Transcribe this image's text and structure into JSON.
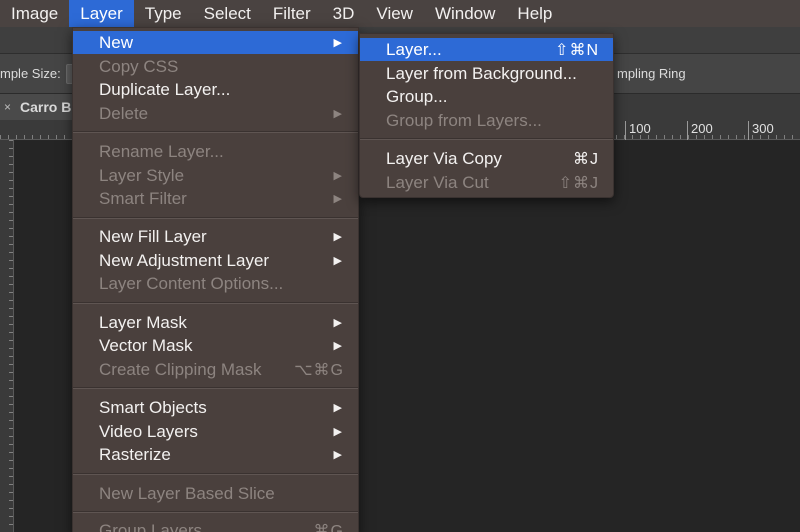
{
  "menubar": {
    "items": [
      "Image",
      "Layer",
      "Type",
      "Select",
      "Filter",
      "3D",
      "View",
      "Window",
      "Help"
    ],
    "active_index": 1
  },
  "options_bar": {
    "sample_size_label": "mple Size:",
    "sampling_ring_label": "mpling Ring"
  },
  "document_tab": {
    "close_glyph": "×",
    "name": "Carro B"
  },
  "ruler": {
    "ticks": [
      "100",
      "200",
      "300"
    ]
  },
  "layer_menu": {
    "items": [
      {
        "label": "New",
        "arrow": "▶",
        "shortcut": "",
        "state": "highlight"
      },
      {
        "label": "Copy CSS",
        "arrow": "",
        "shortcut": "",
        "state": "disabled"
      },
      {
        "label": "Duplicate Layer...",
        "arrow": "",
        "shortcut": "",
        "state": "enabled"
      },
      {
        "label": "Delete",
        "arrow": "▶",
        "shortcut": "",
        "state": "disabled"
      },
      {
        "label": "Rename Layer...",
        "arrow": "",
        "shortcut": "",
        "state": "disabled"
      },
      {
        "label": "Layer Style",
        "arrow": "▶",
        "shortcut": "",
        "state": "disabled"
      },
      {
        "label": "Smart Filter",
        "arrow": "▶",
        "shortcut": "",
        "state": "disabled"
      },
      {
        "label": "New Fill Layer",
        "arrow": "▶",
        "shortcut": "",
        "state": "enabled"
      },
      {
        "label": "New Adjustment Layer",
        "arrow": "▶",
        "shortcut": "",
        "state": "enabled"
      },
      {
        "label": "Layer Content Options...",
        "arrow": "",
        "shortcut": "",
        "state": "disabled"
      },
      {
        "label": "Layer Mask",
        "arrow": "▶",
        "shortcut": "",
        "state": "enabled"
      },
      {
        "label": "Vector Mask",
        "arrow": "▶",
        "shortcut": "",
        "state": "enabled"
      },
      {
        "label": "Create Clipping Mask",
        "arrow": "",
        "shortcut": "⌥⌘G",
        "state": "disabled"
      },
      {
        "label": "Smart Objects",
        "arrow": "▶",
        "shortcut": "",
        "state": "enabled"
      },
      {
        "label": "Video Layers",
        "arrow": "▶",
        "shortcut": "",
        "state": "enabled"
      },
      {
        "label": "Rasterize",
        "arrow": "▶",
        "shortcut": "",
        "state": "enabled"
      },
      {
        "label": "New Layer Based Slice",
        "arrow": "",
        "shortcut": "",
        "state": "disabled"
      },
      {
        "label": "Group Layers",
        "arrow": "",
        "shortcut": "⌘G",
        "state": "disabled"
      }
    ]
  },
  "new_submenu": {
    "items": [
      {
        "label": "Layer...",
        "shortcut": "⇧⌘N",
        "state": "highlight"
      },
      {
        "label": "Layer from Background...",
        "shortcut": "",
        "state": "enabled"
      },
      {
        "label": "Group...",
        "shortcut": "",
        "state": "enabled"
      },
      {
        "label": "Group from Layers...",
        "shortcut": "",
        "state": "disabled"
      },
      {
        "label": "Layer Via Copy",
        "shortcut": "⌘J",
        "state": "enabled"
      },
      {
        "label": "Layer Via Cut",
        "shortcut": "⇧⌘J",
        "state": "disabled"
      }
    ]
  },
  "colors": {
    "highlight": "#2d6ad6",
    "menu_bg": "#4a403d",
    "menubar_bg": "#4a4341",
    "disabled_text": "#8d8480"
  }
}
